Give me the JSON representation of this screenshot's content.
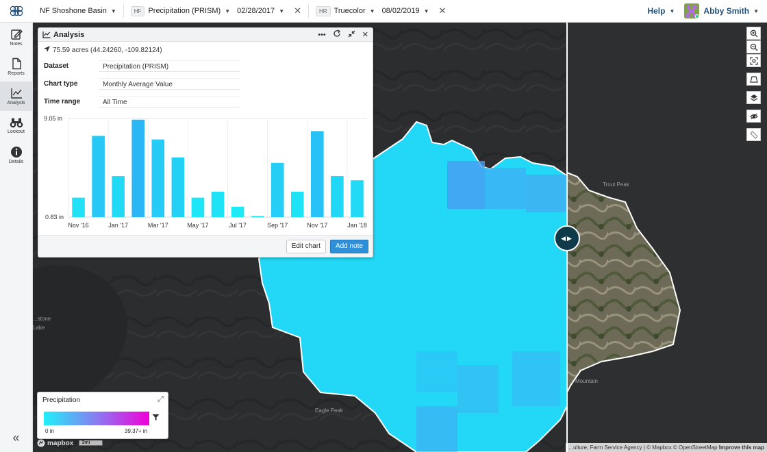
{
  "topbar": {
    "project": "NF Shoshone Basin",
    "layer1": {
      "tag": "HF",
      "name": "Precipitation (PRISM)",
      "date": "02/28/2017"
    },
    "layer2": {
      "tag": "HR",
      "name": "Truecolor",
      "date": "08/02/2019"
    },
    "help": "Help",
    "user": "Abby Smith"
  },
  "sidebar": {
    "items": [
      {
        "label": "Notes",
        "icon": "notes-icon"
      },
      {
        "label": "Reports",
        "icon": "reports-icon"
      },
      {
        "label": "Analysis",
        "icon": "analysis-icon"
      },
      {
        "label": "Lookout",
        "icon": "binoculars-icon"
      },
      {
        "label": "Details",
        "icon": "info-icon"
      }
    ],
    "collapse": "«"
  },
  "analysis": {
    "title": "Analysis",
    "location": "75.59 acres (44.24260, -109.82124)",
    "dataset_label": "Dataset",
    "dataset_value": "Precipitation (PRISM)",
    "chart_type_label": "Chart type",
    "chart_type_value": "Monthly Average Value",
    "time_range_label": "Time range",
    "time_range_value": "All Time",
    "edit_button": "Edit chart",
    "add_button": "Add note"
  },
  "chart_data": {
    "type": "bar",
    "ymax_label": "9.05 in",
    "ymin_label": "0.83 in",
    "ylim": [
      0.83,
      9.05
    ],
    "x_tick_labels": [
      "Nov '16",
      "Jan '17",
      "Mar '17",
      "May '17",
      "Jul '17",
      "Sep '17",
      "Nov '17",
      "Jan '18"
    ],
    "categories": [
      "Nov '16",
      "Dec '16",
      "Jan '17",
      "Feb '17",
      "Mar '17",
      "Apr '17",
      "May '17",
      "Jun '17",
      "Jul '17",
      "Aug '17",
      "Sep '17",
      "Oct '17",
      "Nov '17",
      "Dec '17",
      "Jan '18"
    ],
    "values": [
      2.45,
      7.6,
      4.25,
      8.95,
      7.3,
      5.8,
      2.45,
      2.95,
      1.7,
      0.93,
      5.35,
      2.95,
      8.0,
      4.25,
      3.9
    ],
    "colors": [
      "#22e0f5",
      "#27c8f6",
      "#22d9f6",
      "#2bb6f5",
      "#26ccf6",
      "#24d1f6",
      "#1ee6f6",
      "#1ee3f6",
      "#1ee9f6",
      "#1ef0f6",
      "#25cef6",
      "#1ee3f6",
      "#28c3f6",
      "#21d7f6",
      "#22daf6"
    ]
  },
  "legend": {
    "title": "Precipitation",
    "min": "0 in",
    "max": "39.37+ in",
    "gradient": [
      "#1ff0f8",
      "#8a7bf2",
      "#f000d8"
    ]
  },
  "map": {
    "labels": {
      "trout_peak": "Trout Peak",
      "eagle_peak": "Eagle Peak",
      "mountain": "Mountain",
      "yellowstone": "...stone",
      "lake": "Lake"
    },
    "attribution": "...ulture, Farm Service Agency | © Mapbox © OpenStreetMap",
    "improve": "Improve this map",
    "logo": "mapbox",
    "scale": "3mi"
  }
}
